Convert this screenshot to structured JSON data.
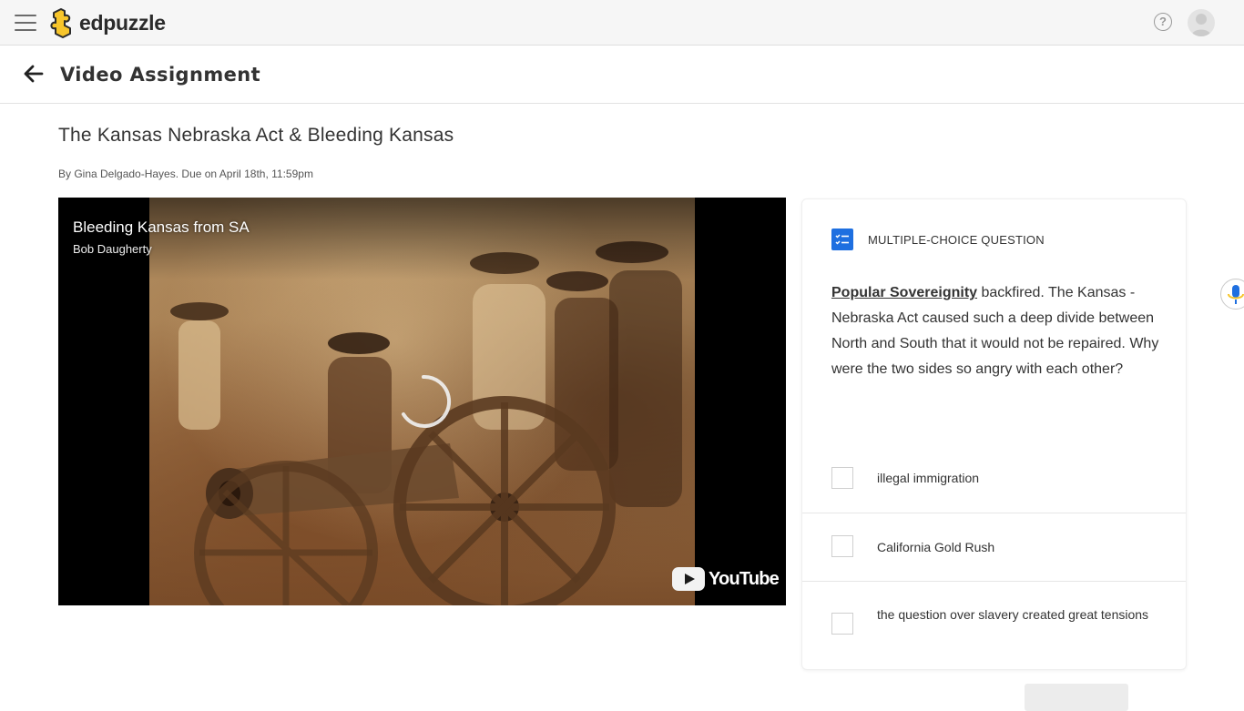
{
  "app": {
    "logo_text": "edpuzzle",
    "help_symbol": "?",
    "menu_icon": "hamburger-icon",
    "brand_color": "#f7c52b"
  },
  "subheader": {
    "title": "Video Assignment",
    "back_icon": "arrow-left-icon"
  },
  "assignment": {
    "title": "The Kansas Nebraska Act & Bleeding Kansas",
    "meta": "By Gina Delgado-Hayes. Due on April 18th, 11:59pm"
  },
  "video": {
    "title": "Bleeding Kansas from SA",
    "channel": "Bob Daugherty",
    "provider_label": "YouTube",
    "state": "loading"
  },
  "question": {
    "type_label": "MULTIPLE-CHOICE QUESTION",
    "keyword": "Popular Sovereignity",
    "text_rest": " backfired.  The Kansas - Nebraska Act caused such a deep divide between North and South that it would not be repaired.  Why were the two sides so angry with each other?",
    "accent_color": "#1e6fe0",
    "options": [
      {
        "label": "illegal immigration",
        "checked": false
      },
      {
        "label": "California Gold Rush",
        "checked": false
      },
      {
        "label": "the question over slavery created great tensions",
        "checked": false
      }
    ]
  }
}
